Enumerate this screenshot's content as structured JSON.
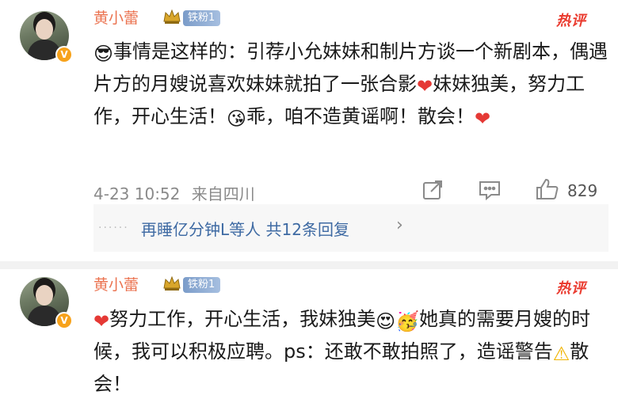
{
  "comments": [
    {
      "username": "黄小蕾",
      "fan_badge": "铁粉1",
      "hot_label": "热评",
      "text": {
        "p1": "事情是这样的：引荐小允妹妹和制片方谈一个新剧本，偶遇片方的月嫂说喜欢妹妹就拍了一张合影",
        "p2": "妹妹独美，努力工作，开心生活！",
        "p3": "乖，咱不造黄谣啊！散会！"
      },
      "timestamp": "4-23 10:52",
      "location": "来自四川",
      "likes": "829",
      "replies_summary": "再睡亿分钟L等人 共12条回复",
      "chevron": "›"
    },
    {
      "username": "黄小蕾",
      "fan_badge": "铁粉1",
      "hot_label": "热评",
      "text": {
        "p1": "努力工作，开心生活，我妹独美",
        "p2": "她真的需要月嫂的时候，我可以积极应聘。ps：还敢不敢拍照了，造谣警告",
        "p3": "散会！"
      }
    }
  ],
  "icons": {
    "sunglasses": "😎",
    "heart": "❤",
    "kiss_face": "😘",
    "heart_eyes": "😍",
    "party_face": "🥳",
    "warning": "⚠",
    "crown": "👑",
    "verified": "V",
    "share": "share-icon",
    "comment": "comment-icon",
    "like": "thumbs-up-icon"
  },
  "colors": {
    "username": "#eb7350",
    "hot": "#ea3a2e",
    "link": "#3e6aa3",
    "meta": "#8a8a8a"
  }
}
